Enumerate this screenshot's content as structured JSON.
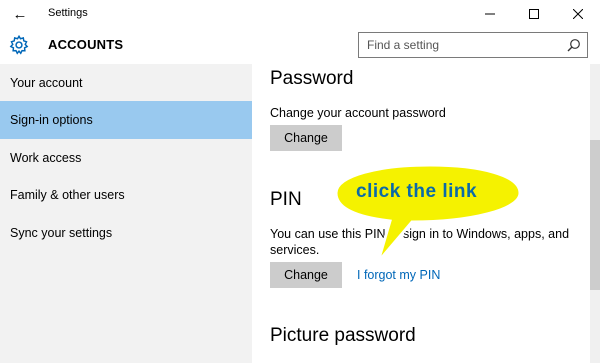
{
  "window": {
    "title": "Settings",
    "back_icon": "←",
    "minimize_icon": "—",
    "maximize_icon": "☐",
    "close_icon": "✕"
  },
  "header": {
    "title": "ACCOUNTS",
    "search_placeholder": "Find a setting"
  },
  "sidebar": {
    "items": [
      {
        "label": "Your account"
      },
      {
        "label": "Sign-in options"
      },
      {
        "label": "Work access"
      },
      {
        "label": "Family & other users"
      },
      {
        "label": "Sync your settings"
      }
    ]
  },
  "password": {
    "heading": "Password",
    "description": "Change your account password",
    "button_label": "Change"
  },
  "pin": {
    "heading": "PIN",
    "description_line1": "You can use this PIN to sign in to Windows, apps, and",
    "description_line2": "services.",
    "button_label": "Change",
    "forgot_link": "I forgot my PIN"
  },
  "picture_password": {
    "heading": "Picture password"
  },
  "callout": {
    "text": "click the link"
  },
  "colors": {
    "accent": "#0067b8",
    "selected_bg": "#99c9ef",
    "sidebar_bg": "#f2f2f2",
    "button_bg": "#cccccc",
    "callout_fill": "#f5f200",
    "callout_text": "#0b6aa8"
  }
}
